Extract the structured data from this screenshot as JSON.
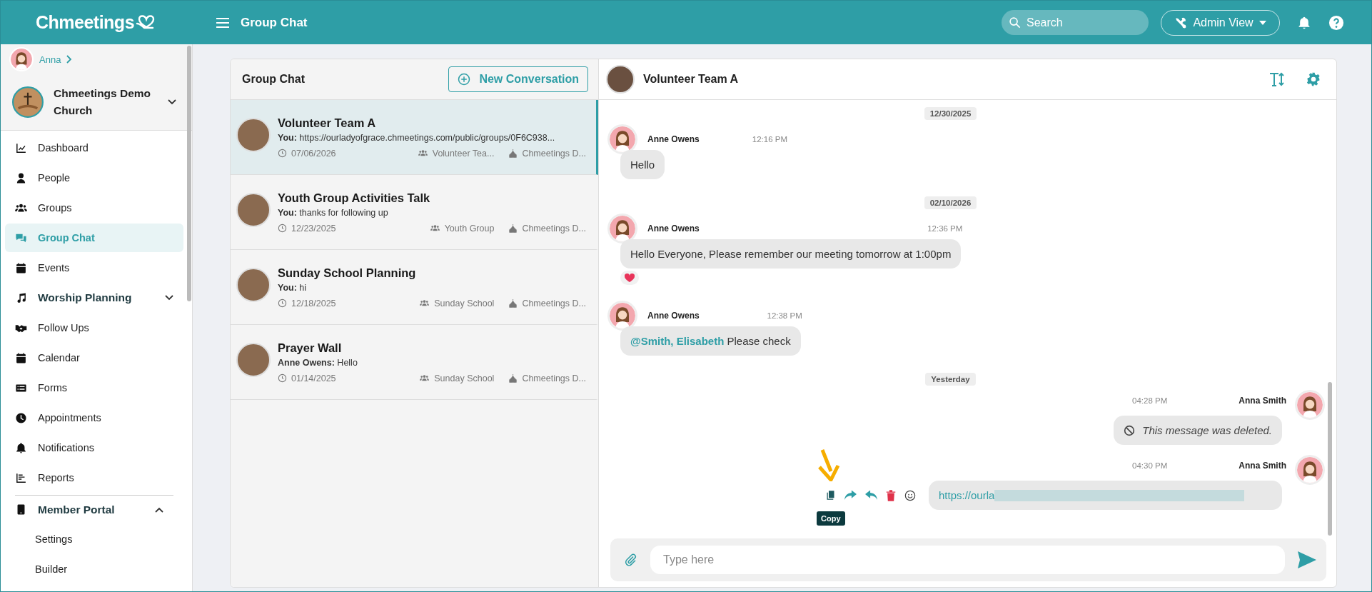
{
  "header": {
    "logo": "Chmeetings",
    "title": "Group Chat",
    "search": {
      "placeholder": "Search"
    },
    "view_button": "Admin View"
  },
  "sidebar": {
    "user": "Anna",
    "organization": "Chmeetings Demo Church",
    "items": [
      {
        "kind": "item",
        "label": "Dashboard",
        "selected": false
      },
      {
        "kind": "item",
        "label": "People",
        "selected": false
      },
      {
        "kind": "item",
        "label": "Groups",
        "selected": false
      },
      {
        "kind": "item",
        "label": "Group Chat",
        "selected": true
      },
      {
        "kind": "item",
        "label": "Events",
        "selected": false
      },
      {
        "kind": "section",
        "label": "Worship Planning",
        "expanded": false
      },
      {
        "kind": "item",
        "label": "Follow Ups",
        "selected": false
      },
      {
        "kind": "item",
        "label": "Calendar",
        "selected": false
      },
      {
        "kind": "item",
        "label": "Forms",
        "selected": false
      },
      {
        "kind": "item",
        "label": "Appointments",
        "selected": false
      },
      {
        "kind": "item",
        "label": "Notifications",
        "selected": false
      },
      {
        "kind": "item",
        "label": "Reports",
        "selected": false
      },
      {
        "kind": "section",
        "label": "Member Portal",
        "expanded": true
      },
      {
        "kind": "subitem",
        "label": "Settings",
        "selected": false
      },
      {
        "kind": "subitem",
        "label": "Builder",
        "selected": false
      }
    ]
  },
  "conversation_list": {
    "title": "Group Chat",
    "new_button": "New Conversation",
    "conversations": [
      {
        "name": "Volunteer Team A",
        "sender": "You:",
        "preview": "https://ourladyofgrace.chmeetings.com/public/groups/0F6C938...",
        "date": "07/06/2026",
        "group": "Volunteer Tea...",
        "church": "Chmeetings D...",
        "selected": true
      },
      {
        "name": "Youth Group Activities Talk",
        "sender": "You:",
        "preview": "thanks for following up",
        "date": "12/23/2025",
        "group": "Youth Group",
        "church": "Chmeetings D...",
        "selected": false
      },
      {
        "name": "Sunday School Planning",
        "sender": "You:",
        "preview": "hi",
        "date": "12/18/2025",
        "group": "Sunday School",
        "church": "Chmeetings D...",
        "selected": false
      },
      {
        "name": "Prayer Wall",
        "sender": "Anne Owens:",
        "preview": "Hello",
        "date": "01/14/2025",
        "group": "Sunday School",
        "church": "Chmeetings D...",
        "selected": false
      }
    ]
  },
  "chat": {
    "title": "Volunteer Team A",
    "messages": [
      {
        "kind": "date",
        "text": "12/30/2025"
      },
      {
        "kind": "incoming",
        "sender": "Anne Owens",
        "time": "12:16 PM",
        "text": "Hello",
        "reacted": false
      },
      {
        "kind": "date",
        "text": "02/10/2026"
      },
      {
        "kind": "incoming",
        "sender": "Anne Owens",
        "time": "12:36 PM",
        "text": "Hello Everyone, Please remember our meeting tomorrow at 1:00pm",
        "reacted": true
      },
      {
        "kind": "incoming",
        "sender": "Anne Owens",
        "time": "12:38 PM",
        "mention": "@Smith, Elisabeth",
        "text": "Please check",
        "reacted": false
      },
      {
        "kind": "date",
        "text": "Yesterday"
      },
      {
        "kind": "outgoing",
        "sender": "Anna Smith",
        "time": "04:28 PM",
        "deleted": true,
        "text": "This message was deleted.",
        "hovered": false
      },
      {
        "kind": "outgoing",
        "sender": "Anna Smith",
        "time": "04:30 PM",
        "deleted": false,
        "text": "https://ourla",
        "redacted": true,
        "hovered": true
      }
    ],
    "tooltip": "Copy",
    "composer": {
      "placeholder": "Type here"
    }
  }
}
